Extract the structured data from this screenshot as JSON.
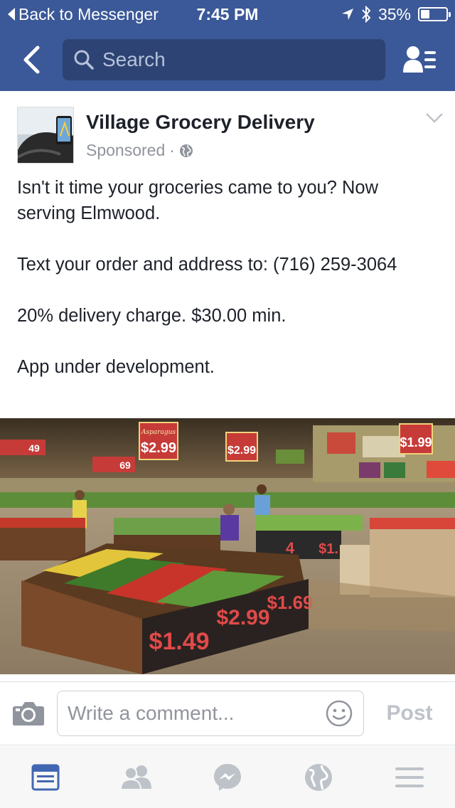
{
  "status_bar": {
    "back_label": "Back to Messenger",
    "time": "7:45 PM",
    "battery": "35%",
    "battery_level": 0.35,
    "icons": [
      "location-arrow-icon",
      "bluetooth-icon",
      "battery-icon"
    ]
  },
  "nav": {
    "search_placeholder": "Search",
    "icons": [
      "back-chevron-icon",
      "search-icon",
      "friend-requests-icon"
    ]
  },
  "post": {
    "page_name": "Village Grocery Delivery",
    "sponsored": "Sponsored",
    "separator": "·",
    "paragraphs": [
      "Isn't it time your groceries came to you? Now serving Elmwood.",
      "Text your order and address to:  (716) 259-3064",
      "20% delivery charge. $30.00 min.",
      "App under development."
    ],
    "image": {
      "signs": {
        "asparagus": "Asparagus",
        "p1": "$2.99",
        "p2": "$2.99",
        "p3": "$1.99",
        "p4": "$1.49",
        "p5": "$2.99",
        "p6": "$1.69",
        "p7": "49",
        "p8": "69",
        "p9": "4",
        "p10": "$1."
      }
    }
  },
  "comment": {
    "placeholder": "Write a comment...",
    "post_label": "Post"
  },
  "tabs": [
    "news-feed-icon",
    "friends-icon",
    "messenger-icon",
    "globe-icon",
    "menu-icon"
  ],
  "colors": {
    "brand": "#3b5998",
    "search_bg": "#2d4373",
    "active_tab": "#4267b2",
    "inactive_tab": "#bec3c9"
  }
}
